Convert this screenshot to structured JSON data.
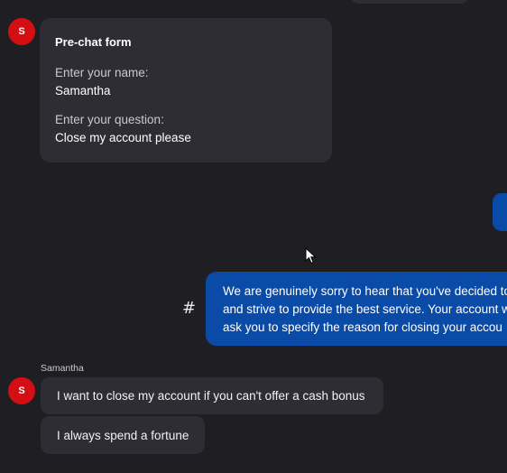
{
  "avatar_initial": "S",
  "prechat_form": {
    "title": "Pre-chat form",
    "name_label": "Enter your name:",
    "name_value": "Samantha",
    "question_label": "Enter your question:",
    "question_value": "Close my account please"
  },
  "agent_reply": {
    "lines": [
      "We are genuinely sorry to hear that you've decided to",
      "and strive to provide the best service. Your account w",
      "ask you to specify the reason for closing your accou"
    ],
    "action_icon": "#"
  },
  "customer": {
    "sender_name": "Samantha",
    "messages": [
      "I want to close my account if you can't offer a cash bonus",
      "I always spend a fortune"
    ]
  },
  "colors": {
    "background": "#1f1f23",
    "incoming_bubble": "#2d2d33",
    "outgoing_bubble": "#0b4ba8",
    "avatar": "#d40f14"
  }
}
